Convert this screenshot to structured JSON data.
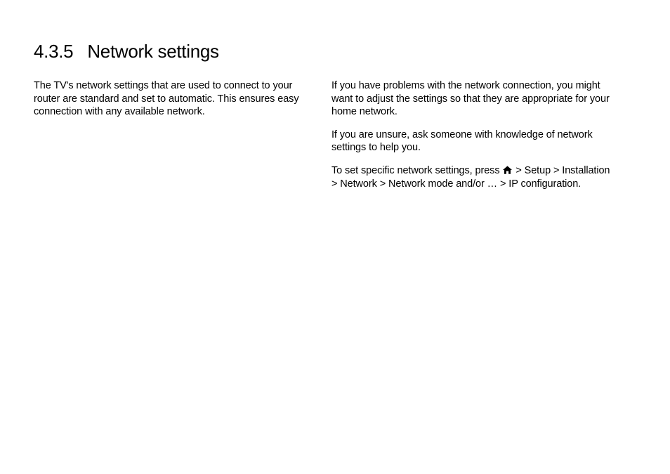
{
  "heading": {
    "number": "4.3.5",
    "title": "Network settings"
  },
  "left_column": {
    "p1": "The TV's network settings that are used to connect to your router are standard and set to automatic. This ensures easy connection with any available network."
  },
  "right_column": {
    "p1": "If you have problems with the network connection, you might want to adjust the settings so that they are appropriate for your home network.",
    "p2": "If you are unsure, ask someone with knowledge of network settings to help you.",
    "p3_prefix": "To set specific network settings, press ",
    "p3_suffix": " > Setup > Installation > Network > Network mode and/or … > IP configuration."
  }
}
